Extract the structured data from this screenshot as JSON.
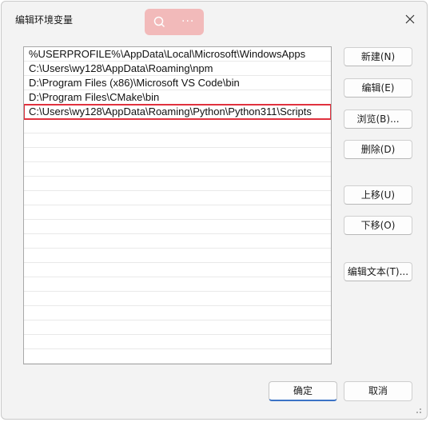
{
  "window": {
    "title": "编辑环境变量"
  },
  "floating_toolbar": {
    "search_icon": "search-icon",
    "more_label": "···"
  },
  "path_list": {
    "items": [
      "%USERPROFILE%\\AppData\\Local\\Microsoft\\WindowsApps",
      "C:\\Users\\wy128\\AppData\\Roaming\\npm",
      "D:\\Program Files (x86)\\Microsoft VS Code\\bin",
      "D:\\Program Files\\CMake\\bin",
      "C:\\Users\\wy128\\AppData\\Roaming\\Python\\Python311\\Scripts"
    ],
    "selected_index": 4,
    "highlight_color": "#e0313e"
  },
  "buttons": {
    "new": "新建(N)",
    "edit": "编辑(E)",
    "browse": "浏览(B)...",
    "delete": "删除(D)",
    "move_up": "上移(U)",
    "move_down": "下移(O)",
    "edit_text": "编辑文本(T)...",
    "ok": "确定",
    "cancel": "取消"
  },
  "colors": {
    "accent": "#3b73c6"
  }
}
